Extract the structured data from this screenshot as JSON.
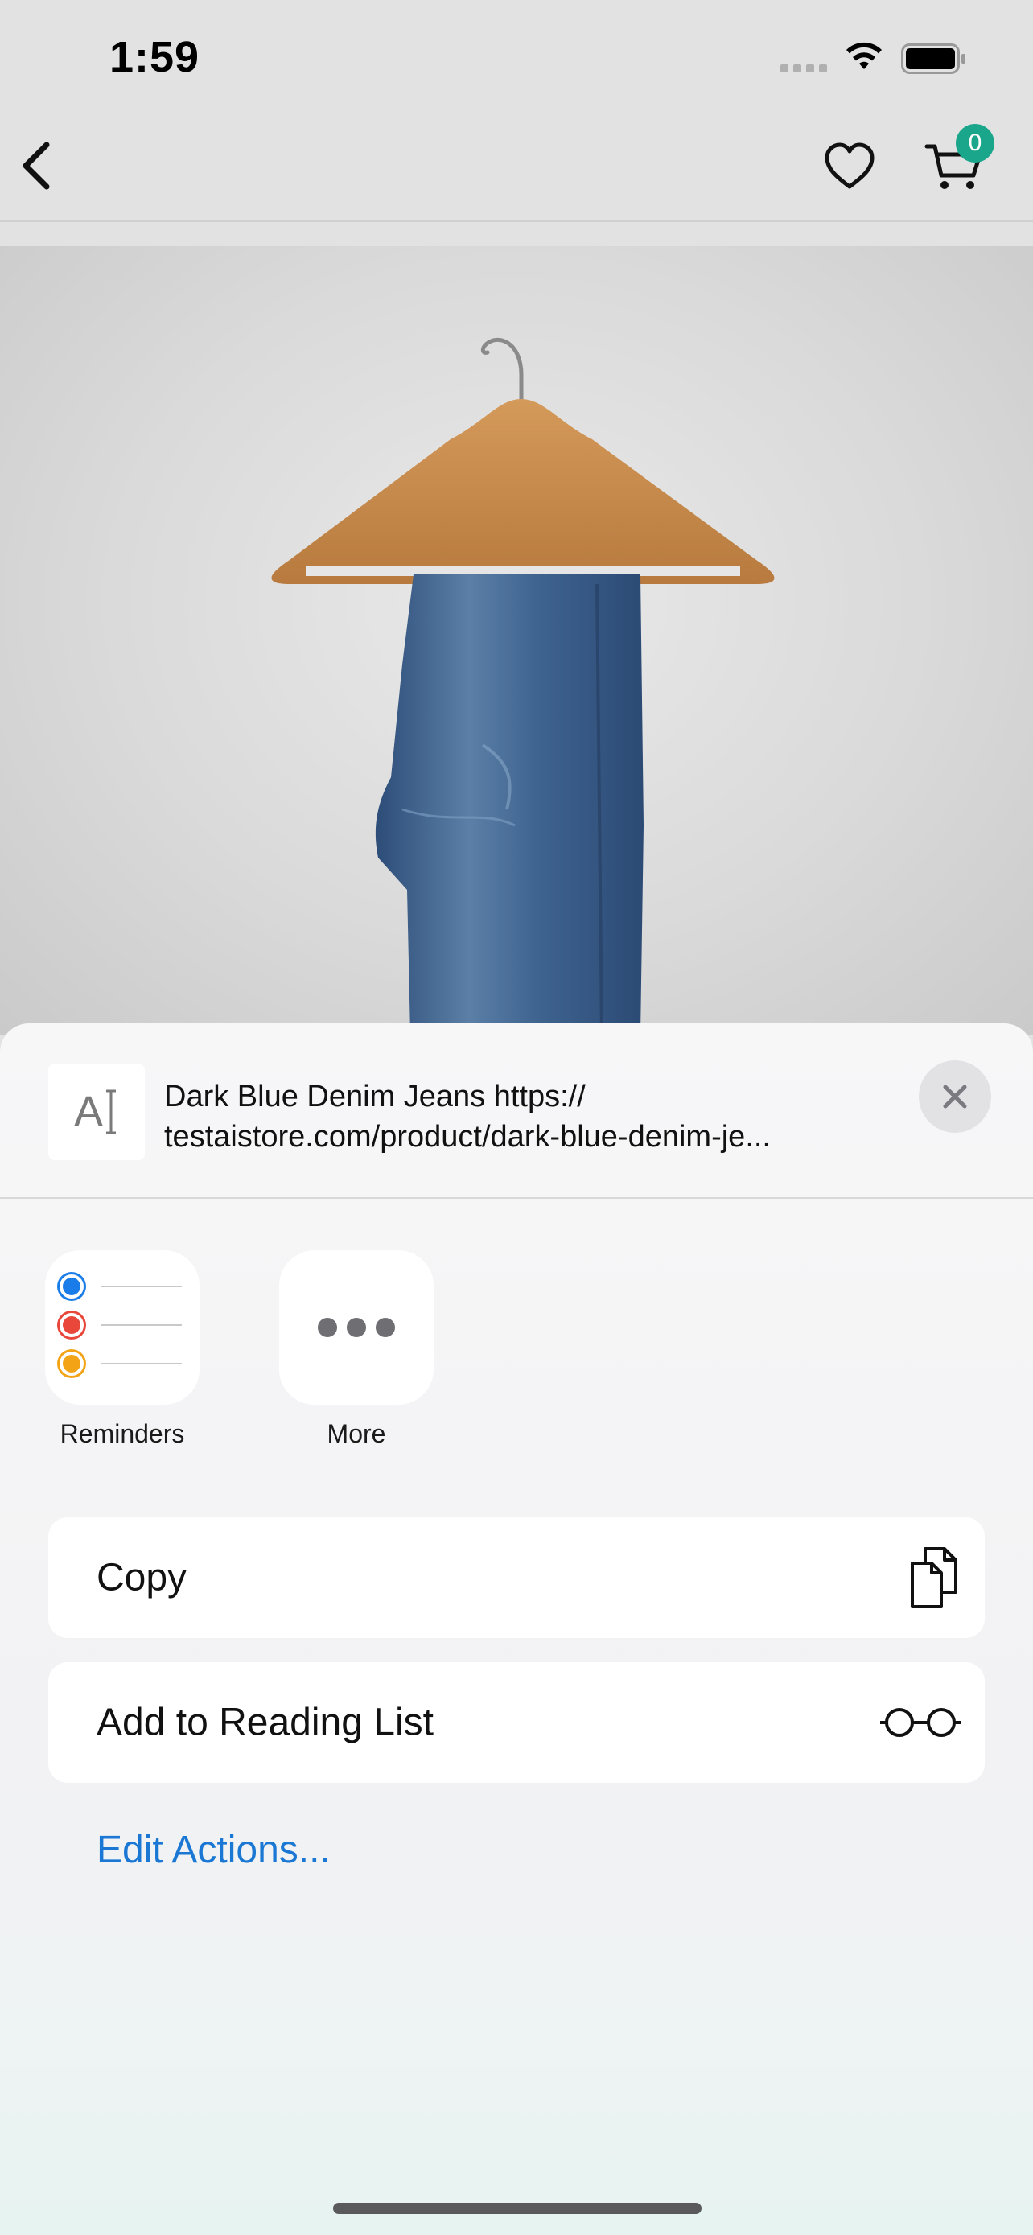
{
  "status_bar": {
    "time": "1:59",
    "icons": [
      "signal-icon",
      "wifi-icon",
      "battery-icon"
    ]
  },
  "nav": {
    "back_icon": "chevron-left-icon",
    "wishlist_icon": "heart-icon",
    "cart_icon": "cart-icon",
    "cart_count": "0",
    "badge_color": "#1aa68a"
  },
  "product": {
    "image_icon": "jeans-on-hanger-image"
  },
  "share_sheet": {
    "thumb_glyph": "A",
    "title_line1": "Dark Blue Denim Jeans  https://",
    "title_line2": "testaistore.com/product/dark-blue-denim-je...",
    "close_icon": "close-icon",
    "apps": [
      {
        "label": "Reminders",
        "icon": "reminders-icon"
      },
      {
        "label": "More",
        "icon": "more-icon"
      }
    ],
    "actions": [
      {
        "label": "Copy",
        "icon": "copy-icon"
      },
      {
        "label": "Add to Reading List",
        "icon": "glasses-icon"
      }
    ],
    "edit_actions": "Edit Actions...",
    "link_color": "#1a78d4"
  }
}
